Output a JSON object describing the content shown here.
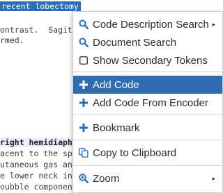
{
  "document": {
    "lines": [
      "recent lobectomy",
      "ontrast.  Sagitt",
      "rmed.",
      "right hemidiaphr",
      "acent to the spl",
      "utaneous gas and",
      "e lower neck in",
      "oubble component"
    ]
  },
  "context_menu": {
    "items": [
      {
        "label": "Code Description Search",
        "icon": "search-icon",
        "submenu": true
      },
      {
        "label": "Document Search",
        "icon": "search-icon",
        "submenu": false
      },
      {
        "label": "Show Secondary Tokens",
        "icon": "checkbox-icon",
        "submenu": false
      },
      {
        "label": "Add Code",
        "icon": "plus-icon",
        "submenu": false,
        "active": true
      },
      {
        "label": "Add Code From Encoder",
        "icon": "plus-icon",
        "submenu": false
      },
      {
        "label": "Bookmark",
        "icon": "plus-icon",
        "submenu": false
      },
      {
        "label": "Copy to Clipboard",
        "icon": "copy-icon",
        "submenu": false
      },
      {
        "label": "Zoom",
        "icon": "zoom-in-icon",
        "submenu": true
      }
    ],
    "submenu_arrow": "▸"
  },
  "colors": {
    "accent": "#2e6db0",
    "icon_blue": "#2a6fb5"
  }
}
